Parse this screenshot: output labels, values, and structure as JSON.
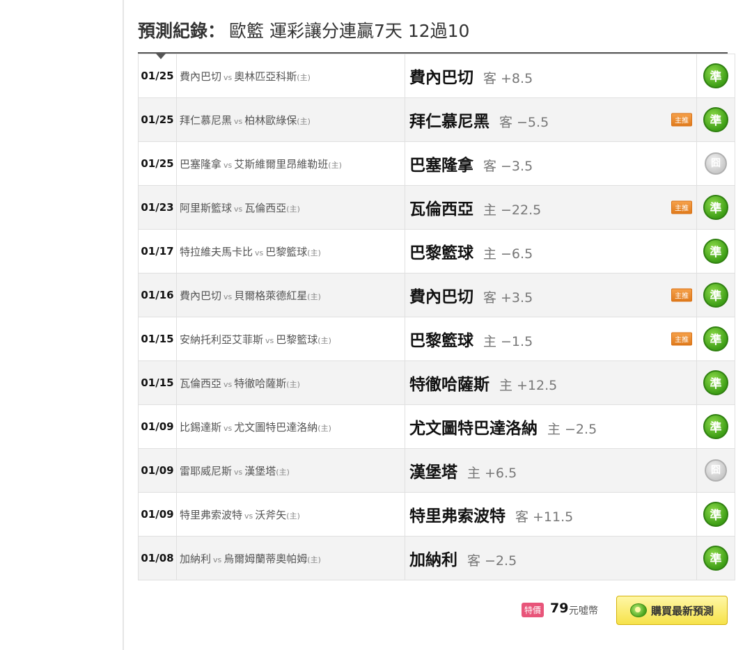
{
  "header": {
    "title_label": "預測紀錄",
    "title_colon": "：",
    "title_detail": "歐籃 運彩讓分連贏7天 12過10"
  },
  "vs_label": "vs",
  "home_label": "(主)",
  "badge_label": "主推",
  "rows": [
    {
      "date": "01/25",
      "away": "費內巴切",
      "home": "奧林匹亞科斯",
      "pick_team": "費內巴切",
      "side": "客",
      "line": "+8.5",
      "featured": false,
      "result": "準",
      "result_type": "win"
    },
    {
      "date": "01/25",
      "away": "拜仁慕尼黑",
      "home": "柏林歐綠保",
      "pick_team": "拜仁慕尼黑",
      "side": "客",
      "line": "−5.5",
      "featured": true,
      "result": "準",
      "result_type": "win"
    },
    {
      "date": "01/25",
      "away": "巴塞隆拿",
      "home": "艾斯維爾里昂維勒班",
      "pick_team": "巴塞隆拿",
      "side": "客",
      "line": "−3.5",
      "featured": false,
      "result": "囧",
      "result_type": "push"
    },
    {
      "date": "01/23",
      "away": "阿里斯籃球",
      "home": "瓦倫西亞",
      "pick_team": "瓦倫西亞",
      "side": "主",
      "line": "−22.5",
      "featured": true,
      "result": "準",
      "result_type": "win"
    },
    {
      "date": "01/17",
      "away": "特拉維夫馬卡比",
      "home": "巴黎籃球",
      "pick_team": "巴黎籃球",
      "side": "主",
      "line": "−6.5",
      "featured": false,
      "result": "準",
      "result_type": "win"
    },
    {
      "date": "01/16",
      "away": "費內巴切",
      "home": "貝爾格萊德紅星",
      "pick_team": "費內巴切",
      "side": "客",
      "line": "+3.5",
      "featured": true,
      "result": "準",
      "result_type": "win"
    },
    {
      "date": "01/15",
      "away": "安納托利亞艾菲斯",
      "home": "巴黎籃球",
      "pick_team": "巴黎籃球",
      "side": "主",
      "line": "−1.5",
      "featured": true,
      "result": "準",
      "result_type": "win"
    },
    {
      "date": "01/15",
      "away": "瓦倫西亞",
      "home": "特徹哈薩斯",
      "pick_team": "特徹哈薩斯",
      "side": "主",
      "line": "+12.5",
      "featured": false,
      "result": "準",
      "result_type": "win"
    },
    {
      "date": "01/09",
      "away": "比錫達斯",
      "home": "尤文圖特巴達洛納",
      "pick_team": "尤文圖特巴達洛納",
      "side": "主",
      "line": "−2.5",
      "featured": false,
      "result": "準",
      "result_type": "win"
    },
    {
      "date": "01/09",
      "away": "雷耶威尼斯",
      "home": "漢堡塔",
      "pick_team": "漢堡塔",
      "side": "主",
      "line": "+6.5",
      "featured": false,
      "result": "囧",
      "result_type": "push"
    },
    {
      "date": "01/09",
      "away": "特里弗索波特",
      "home": "沃斧矢",
      "pick_team": "特里弗索波特",
      "side": "客",
      "line": "+11.5",
      "featured": false,
      "result": "準",
      "result_type": "win"
    },
    {
      "date": "01/08",
      "away": "加納利",
      "home": "烏爾姆蘭蒂奧帕姆",
      "pick_team": "加納利",
      "side": "客",
      "line": "−2.5",
      "featured": false,
      "result": "準",
      "result_type": "win"
    }
  ],
  "footer": {
    "special_badge": "特價",
    "price": "79",
    "currency": "元噓幣",
    "buy_label": "購買最新預測",
    "buy_icon": "coin-icon"
  }
}
